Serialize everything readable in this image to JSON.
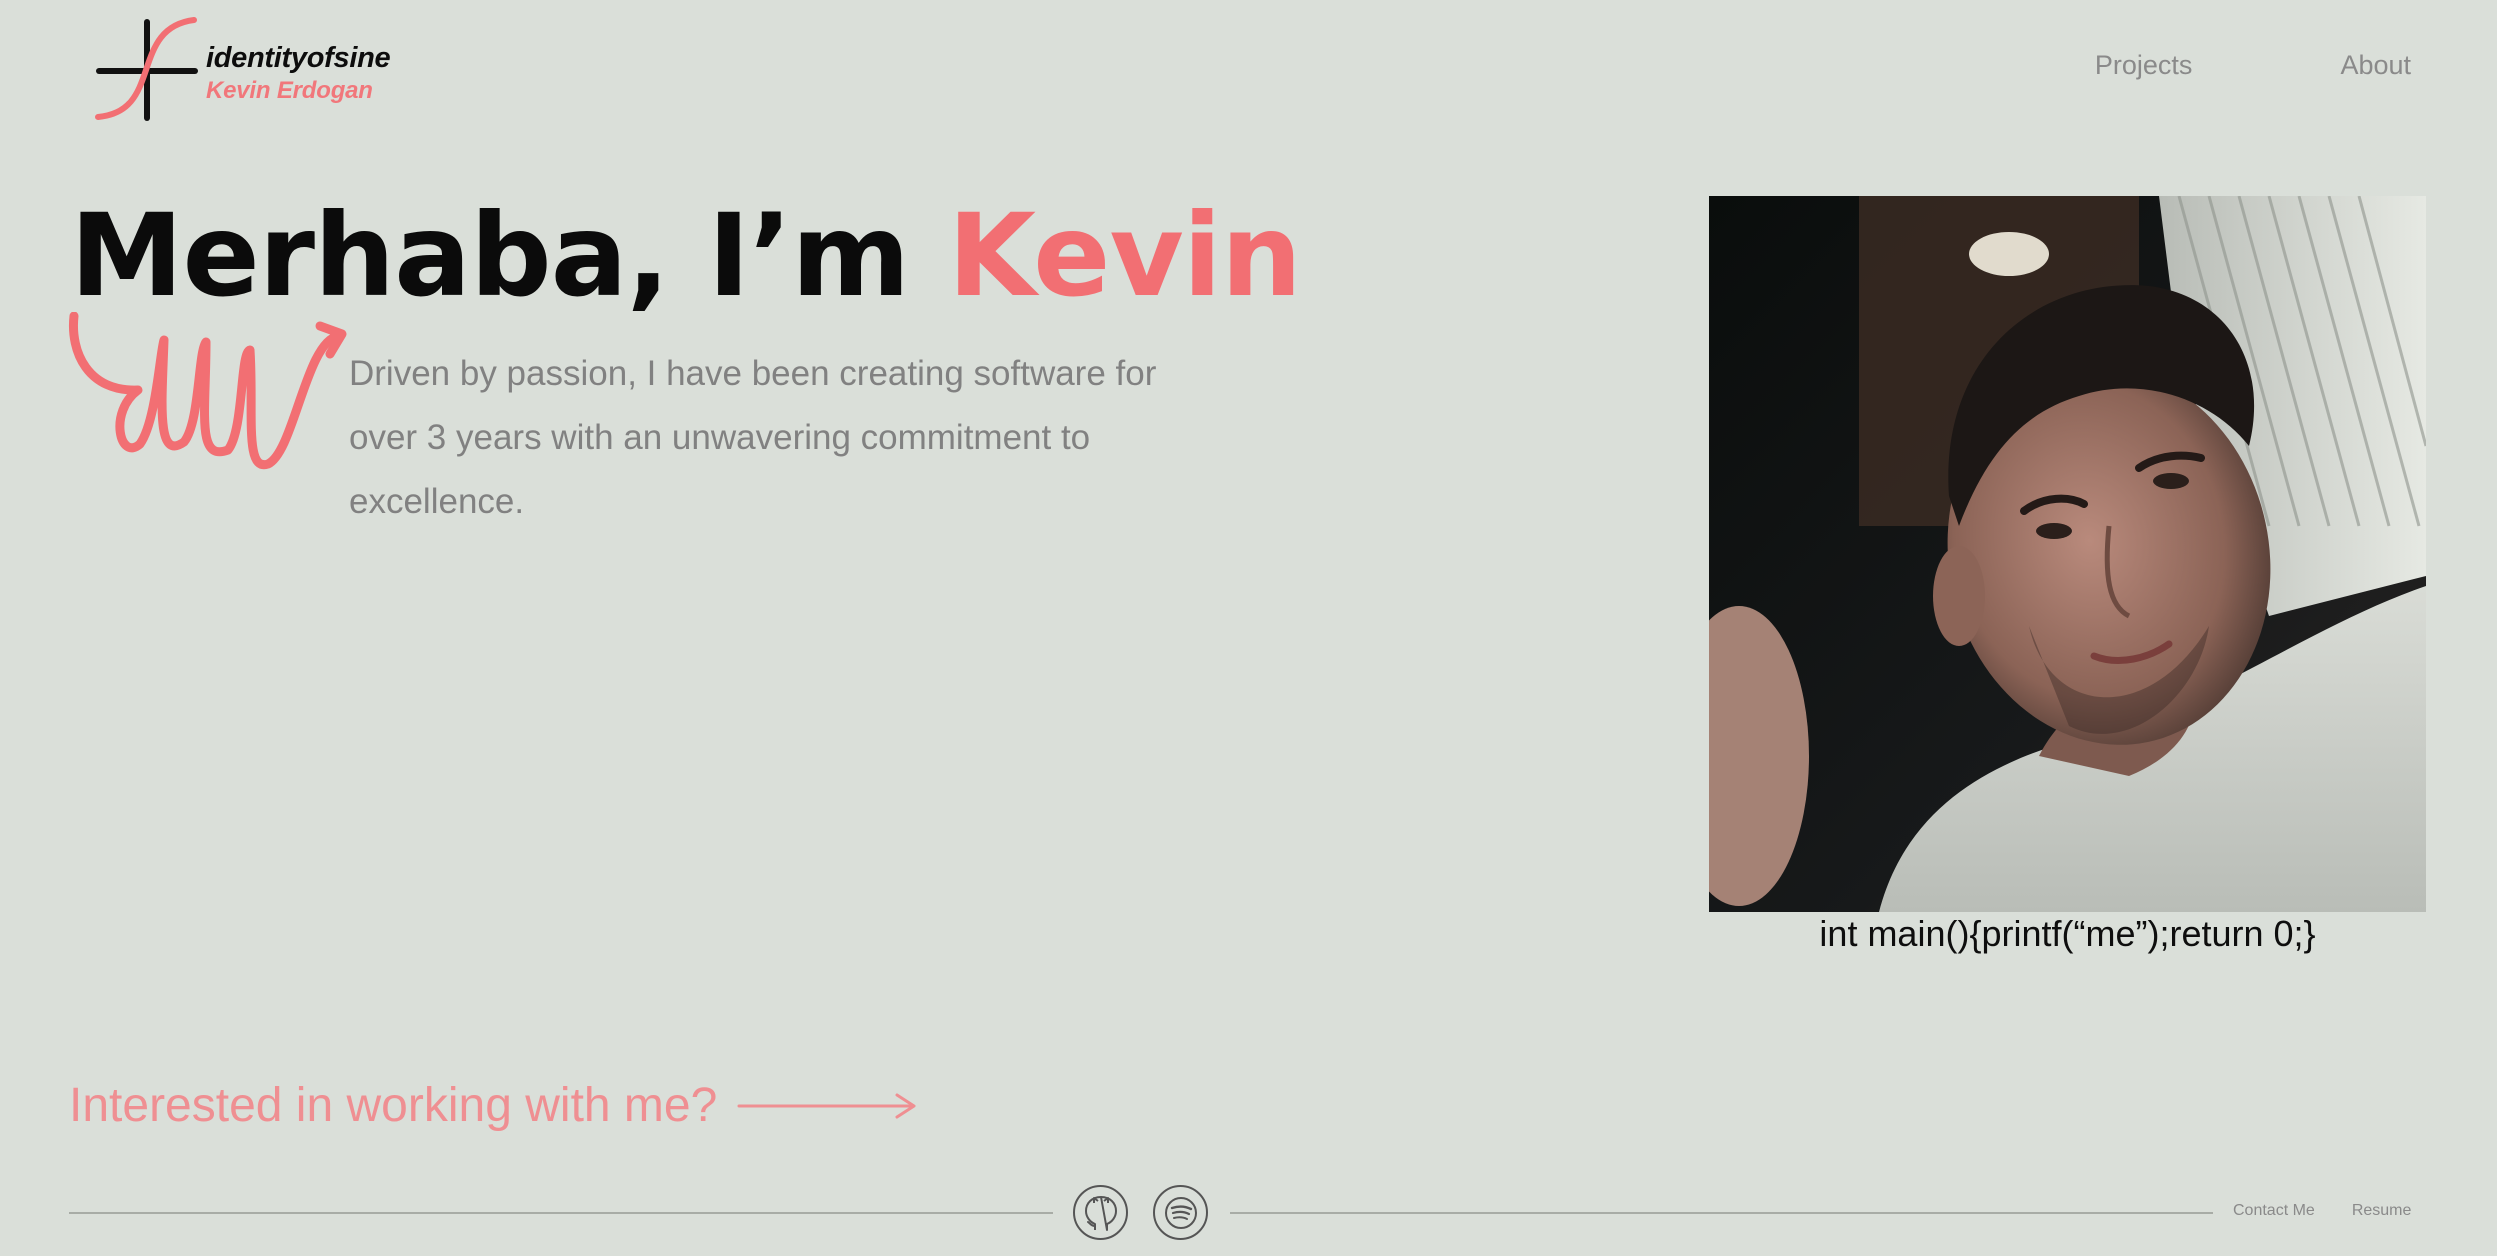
{
  "brand": {
    "title": "identityofsine",
    "subtitle": "Kevin Erdogan",
    "logo_icon": "plus-sine-logo-icon"
  },
  "nav": {
    "items": [
      {
        "label": "Projects"
      },
      {
        "label": "About"
      }
    ]
  },
  "hero": {
    "greeting": "Merhaba, I’m ",
    "name": "Kevin",
    "intro": "Driven by passion, I have been creating software for over 3 years with an unwavering commitment to excellence.",
    "decoration_icon": "squiggle-arrow-icon"
  },
  "portrait": {
    "caption": "int main(){printf(“me”);return 0;}"
  },
  "cta": {
    "label": "Interested in working with me?",
    "icon": "arrow-right-icon"
  },
  "footer": {
    "social": [
      {
        "icon": "github-icon"
      },
      {
        "icon": "spotify-icon"
      }
    ],
    "links": [
      {
        "label": "Contact Me"
      },
      {
        "label": "Resume"
      }
    ]
  },
  "colors": {
    "background": "#dadfd9",
    "accent": "#f26f73",
    "text_dark": "#0b0b0b",
    "text_muted": "#818181"
  }
}
